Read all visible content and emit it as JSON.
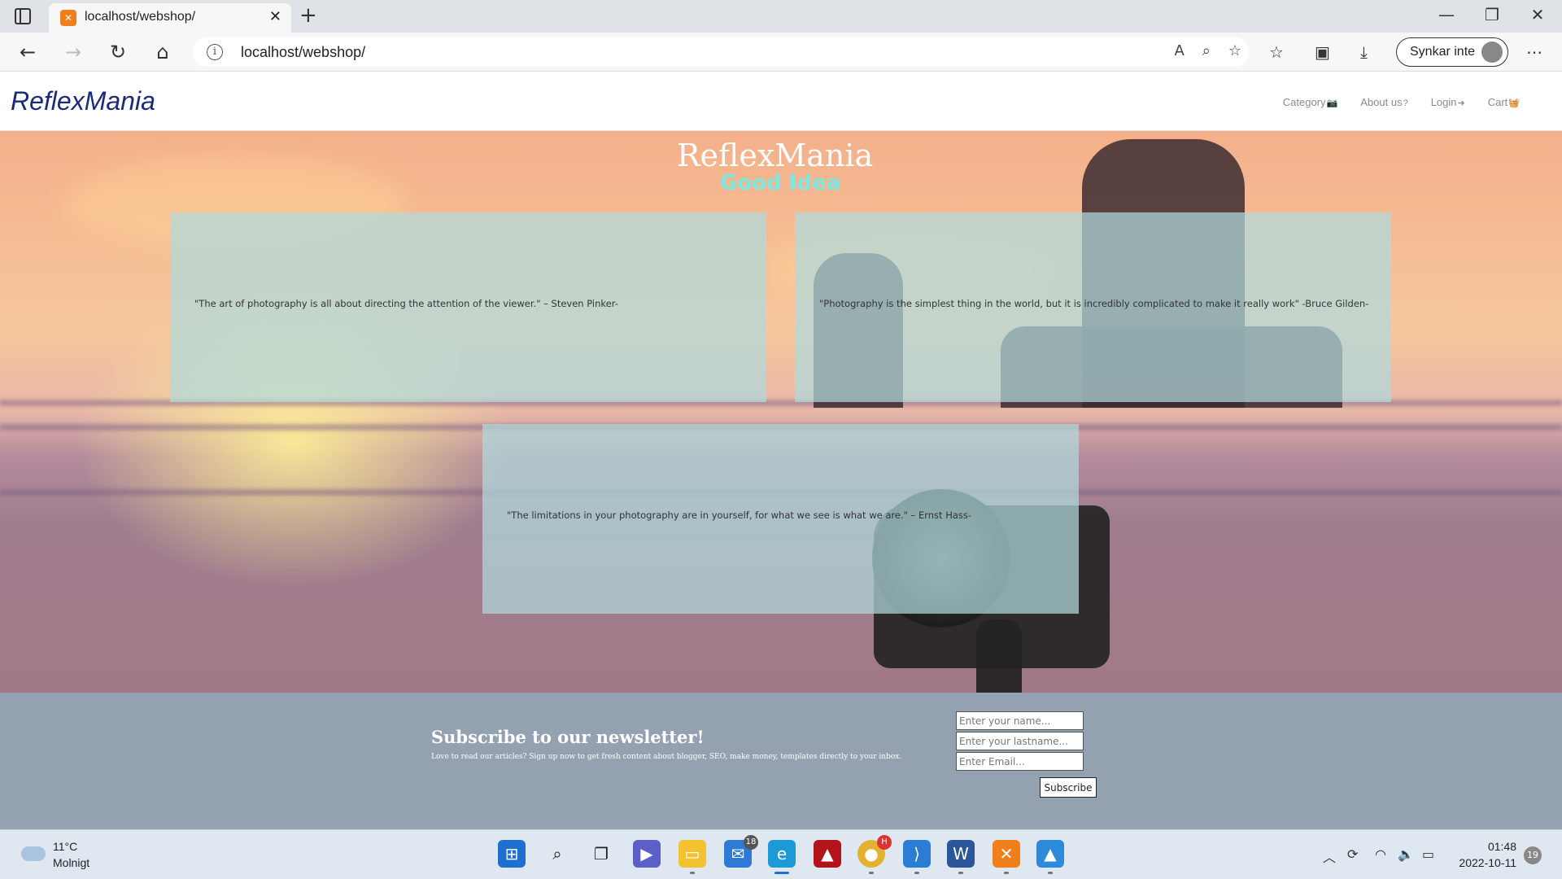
{
  "browser": {
    "tab_title": "localhost/webshop/",
    "address": "localhost/webshop/",
    "sync_label": "Synkar inte"
  },
  "site": {
    "brand": "ReflexMania",
    "nav": [
      {
        "label": "Category",
        "icon": "camera-icon"
      },
      {
        "label": "About us",
        "icon": "question-icon"
      },
      {
        "label": "Login",
        "icon": "login-icon"
      },
      {
        "label": "Cart",
        "icon": "basket-icon"
      }
    ],
    "hero_title": "ReflexMania",
    "hero_subtitle": "Good Idea",
    "quotes": [
      "\"The art of photography is all about directing the attention of the viewer.\" – Steven Pinker-",
      "\"Photography is the simplest thing in the world, but it is incredibly complicated to make it really work\" -Bruce Gilden-",
      "\"The limitations in your photography are in yourself, for what we see is what we are.\" – Ernst Hass-"
    ],
    "newsletter": {
      "title": "Subscribe to our newsletter!",
      "text": "Love to read our articles? Sign up now to get fresh content about blogger, SEO, make money, templates directly to your inbox.",
      "name_placeholder": "Enter your name...",
      "lastname_placeholder": "Enter your lastname...",
      "email_placeholder": "Enter Email...",
      "submit_label": "Subscribe"
    }
  },
  "taskbar": {
    "weather_temp": "11°C",
    "weather_desc": "Molnigt",
    "mail_badge": "18",
    "chrome_badge": "H",
    "time": "01:48",
    "date": "2022-10-11",
    "notifications": "19"
  },
  "colors": {
    "brand": "#1c2a7a",
    "hero_subtitle": "#7de8e0",
    "quote_box": "#b0dadc"
  }
}
